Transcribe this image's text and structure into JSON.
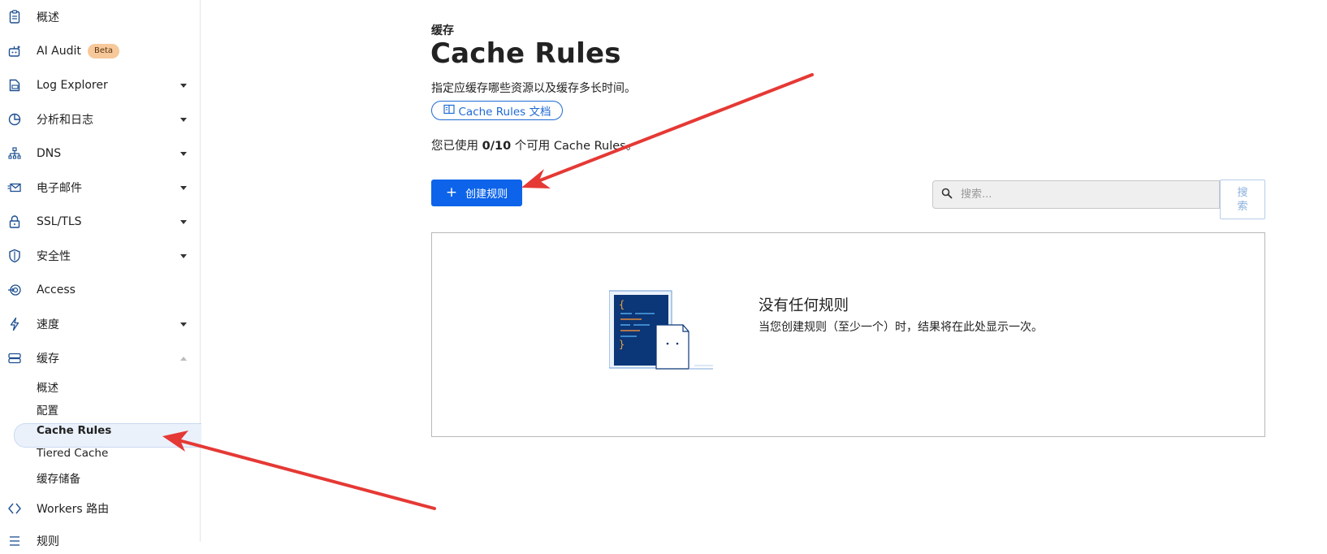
{
  "sidebar": {
    "items": [
      {
        "label": "概述",
        "icon": "clipboard-icon"
      },
      {
        "label": "AI Audit",
        "icon": "robot-icon",
        "badge": "Beta"
      },
      {
        "label": "Log Explorer",
        "icon": "log-icon"
      },
      {
        "label": "分析和日志",
        "icon": "pie-chart-icon"
      },
      {
        "label": "DNS",
        "icon": "network-icon"
      },
      {
        "label": "电子邮件",
        "icon": "mail-icon"
      },
      {
        "label": "SSL/TLS",
        "icon": "lock-icon"
      },
      {
        "label": "安全性",
        "icon": "shield-icon"
      },
      {
        "label": "Access",
        "icon": "access-icon"
      },
      {
        "label": "速度",
        "icon": "bolt-icon"
      },
      {
        "label": "缓存",
        "icon": "storage-icon"
      },
      {
        "label": "Workers 路由",
        "icon": "workers-icon"
      },
      {
        "label": "规则",
        "icon": "rules-icon"
      }
    ],
    "cache_sub": [
      {
        "label": "概述"
      },
      {
        "label": "配置"
      },
      {
        "label": "Cache Rules",
        "active": true
      },
      {
        "label": "Tiered Cache"
      },
      {
        "label": "缓存储备"
      }
    ]
  },
  "main": {
    "breadcrumb": "缓存",
    "title": "Cache Rules",
    "description": "指定应缓存哪些资源以及缓存多长时间。",
    "doc_link": "Cache Rules 文档",
    "usage_prefix": "您已使用 ",
    "usage_count": "0/10",
    "usage_suffix": " 个可用 Cache Rules。",
    "create_button": "创建规则",
    "search_placeholder": "搜索...",
    "search_button": "搜索",
    "empty_title": "没有任何规则",
    "empty_subtitle": "当您创建规则（至少一个）时，结果将在此处显示一次。"
  },
  "colors": {
    "accent": "#0d64ea",
    "link": "#1f6ad4",
    "annotation_arrow": "#e53935",
    "beta_badge": "#f6c89a"
  }
}
